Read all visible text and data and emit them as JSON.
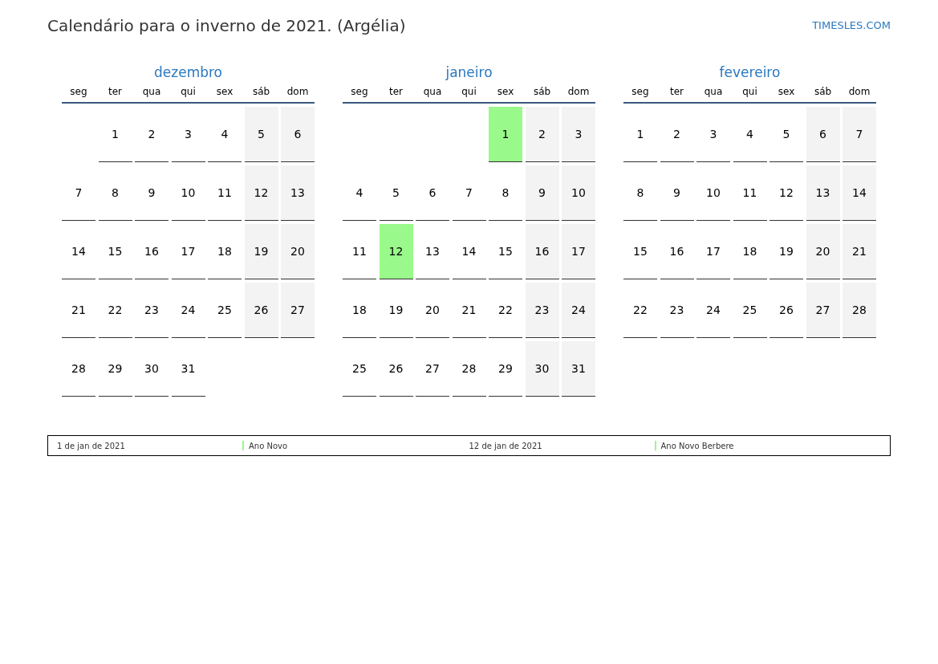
{
  "title": "Calendário para o inverno de 2021. (Argélia)",
  "site": "TIMESLES.COM",
  "months": [
    {
      "name": "dezembro",
      "weekdays": [
        "seg",
        "ter",
        "qua",
        "qui",
        "sex",
        "sáb",
        "dom"
      ],
      "weeks": [
        [
          {
            "kind": "blank"
          },
          {
            "kind": "day",
            "day": "1",
            "weekend": false,
            "holiday": false
          },
          {
            "kind": "day",
            "day": "2",
            "weekend": false,
            "holiday": false
          },
          {
            "kind": "day",
            "day": "3",
            "weekend": false,
            "holiday": false
          },
          {
            "kind": "day",
            "day": "4",
            "weekend": false,
            "holiday": false
          },
          {
            "kind": "day",
            "day": "5",
            "weekend": true,
            "holiday": false
          },
          {
            "kind": "day",
            "day": "6",
            "weekend": true,
            "holiday": false
          }
        ],
        [
          {
            "kind": "day",
            "day": "7",
            "weekend": false,
            "holiday": false
          },
          {
            "kind": "day",
            "day": "8",
            "weekend": false,
            "holiday": false
          },
          {
            "kind": "day",
            "day": "9",
            "weekend": false,
            "holiday": false
          },
          {
            "kind": "day",
            "day": "10",
            "weekend": false,
            "holiday": false
          },
          {
            "kind": "day",
            "day": "11",
            "weekend": false,
            "holiday": false
          },
          {
            "kind": "day",
            "day": "12",
            "weekend": true,
            "holiday": false
          },
          {
            "kind": "day",
            "day": "13",
            "weekend": true,
            "holiday": false
          }
        ],
        [
          {
            "kind": "day",
            "day": "14",
            "weekend": false,
            "holiday": false
          },
          {
            "kind": "day",
            "day": "15",
            "weekend": false,
            "holiday": false
          },
          {
            "kind": "day",
            "day": "16",
            "weekend": false,
            "holiday": false
          },
          {
            "kind": "day",
            "day": "17",
            "weekend": false,
            "holiday": false
          },
          {
            "kind": "day",
            "day": "18",
            "weekend": false,
            "holiday": false
          },
          {
            "kind": "day",
            "day": "19",
            "weekend": true,
            "holiday": false
          },
          {
            "kind": "day",
            "day": "20",
            "weekend": true,
            "holiday": false
          }
        ],
        [
          {
            "kind": "day",
            "day": "21",
            "weekend": false,
            "holiday": false
          },
          {
            "kind": "day",
            "day": "22",
            "weekend": false,
            "holiday": false
          },
          {
            "kind": "day",
            "day": "23",
            "weekend": false,
            "holiday": false
          },
          {
            "kind": "day",
            "day": "24",
            "weekend": false,
            "holiday": false
          },
          {
            "kind": "day",
            "day": "25",
            "weekend": false,
            "holiday": false
          },
          {
            "kind": "day",
            "day": "26",
            "weekend": true,
            "holiday": false
          },
          {
            "kind": "day",
            "day": "27",
            "weekend": true,
            "holiday": false
          }
        ],
        [
          {
            "kind": "day",
            "day": "28",
            "weekend": false,
            "holiday": false
          },
          {
            "kind": "day",
            "day": "29",
            "weekend": false,
            "holiday": false
          },
          {
            "kind": "day",
            "day": "30",
            "weekend": false,
            "holiday": false
          },
          {
            "kind": "day",
            "day": "31",
            "weekend": false,
            "holiday": false
          }
        ]
      ]
    },
    {
      "name": "janeiro",
      "weekdays": [
        "seg",
        "ter",
        "qua",
        "qui",
        "sex",
        "sáb",
        "dom"
      ],
      "weeks": [
        [
          {
            "kind": "blank"
          },
          {
            "kind": "blank"
          },
          {
            "kind": "blank"
          },
          {
            "kind": "blank"
          },
          {
            "kind": "day",
            "day": "1",
            "weekend": false,
            "holiday": true
          },
          {
            "kind": "day",
            "day": "2",
            "weekend": true,
            "holiday": false
          },
          {
            "kind": "day",
            "day": "3",
            "weekend": true,
            "holiday": false
          }
        ],
        [
          {
            "kind": "day",
            "day": "4",
            "weekend": false,
            "holiday": false
          },
          {
            "kind": "day",
            "day": "5",
            "weekend": false,
            "holiday": false
          },
          {
            "kind": "day",
            "day": "6",
            "weekend": false,
            "holiday": false
          },
          {
            "kind": "day",
            "day": "7",
            "weekend": false,
            "holiday": false
          },
          {
            "kind": "day",
            "day": "8",
            "weekend": false,
            "holiday": false
          },
          {
            "kind": "day",
            "day": "9",
            "weekend": true,
            "holiday": false
          },
          {
            "kind": "day",
            "day": "10",
            "weekend": true,
            "holiday": false
          }
        ],
        [
          {
            "kind": "day",
            "day": "11",
            "weekend": false,
            "holiday": false
          },
          {
            "kind": "day",
            "day": "12",
            "weekend": false,
            "holiday": true
          },
          {
            "kind": "day",
            "day": "13",
            "weekend": false,
            "holiday": false
          },
          {
            "kind": "day",
            "day": "14",
            "weekend": false,
            "holiday": false
          },
          {
            "kind": "day",
            "day": "15",
            "weekend": false,
            "holiday": false
          },
          {
            "kind": "day",
            "day": "16",
            "weekend": true,
            "holiday": false
          },
          {
            "kind": "day",
            "day": "17",
            "weekend": true,
            "holiday": false
          }
        ],
        [
          {
            "kind": "day",
            "day": "18",
            "weekend": false,
            "holiday": false
          },
          {
            "kind": "day",
            "day": "19",
            "weekend": false,
            "holiday": false
          },
          {
            "kind": "day",
            "day": "20",
            "weekend": false,
            "holiday": false
          },
          {
            "kind": "day",
            "day": "21",
            "weekend": false,
            "holiday": false
          },
          {
            "kind": "day",
            "day": "22",
            "weekend": false,
            "holiday": false
          },
          {
            "kind": "day",
            "day": "23",
            "weekend": true,
            "holiday": false
          },
          {
            "kind": "day",
            "day": "24",
            "weekend": true,
            "holiday": false
          }
        ],
        [
          {
            "kind": "day",
            "day": "25",
            "weekend": false,
            "holiday": false
          },
          {
            "kind": "day",
            "day": "26",
            "weekend": false,
            "holiday": false
          },
          {
            "kind": "day",
            "day": "27",
            "weekend": false,
            "holiday": false
          },
          {
            "kind": "day",
            "day": "28",
            "weekend": false,
            "holiday": false
          },
          {
            "kind": "day",
            "day": "29",
            "weekend": false,
            "holiday": false
          },
          {
            "kind": "day",
            "day": "30",
            "weekend": true,
            "holiday": false
          },
          {
            "kind": "day",
            "day": "31",
            "weekend": true,
            "holiday": false
          }
        ]
      ]
    },
    {
      "name": "fevereiro",
      "weekdays": [
        "seg",
        "ter",
        "qua",
        "qui",
        "sex",
        "sáb",
        "dom"
      ],
      "weeks": [
        [
          {
            "kind": "day",
            "day": "1",
            "weekend": false,
            "holiday": false
          },
          {
            "kind": "day",
            "day": "2",
            "weekend": false,
            "holiday": false
          },
          {
            "kind": "day",
            "day": "3",
            "weekend": false,
            "holiday": false
          },
          {
            "kind": "day",
            "day": "4",
            "weekend": false,
            "holiday": false
          },
          {
            "kind": "day",
            "day": "5",
            "weekend": false,
            "holiday": false
          },
          {
            "kind": "day",
            "day": "6",
            "weekend": true,
            "holiday": false
          },
          {
            "kind": "day",
            "day": "7",
            "weekend": true,
            "holiday": false
          }
        ],
        [
          {
            "kind": "day",
            "day": "8",
            "weekend": false,
            "holiday": false
          },
          {
            "kind": "day",
            "day": "9",
            "weekend": false,
            "holiday": false
          },
          {
            "kind": "day",
            "day": "10",
            "weekend": false,
            "holiday": false
          },
          {
            "kind": "day",
            "day": "11",
            "weekend": false,
            "holiday": false
          },
          {
            "kind": "day",
            "day": "12",
            "weekend": false,
            "holiday": false
          },
          {
            "kind": "day",
            "day": "13",
            "weekend": true,
            "holiday": false
          },
          {
            "kind": "day",
            "day": "14",
            "weekend": true,
            "holiday": false
          }
        ],
        [
          {
            "kind": "day",
            "day": "15",
            "weekend": false,
            "holiday": false
          },
          {
            "kind": "day",
            "day": "16",
            "weekend": false,
            "holiday": false
          },
          {
            "kind": "day",
            "day": "17",
            "weekend": false,
            "holiday": false
          },
          {
            "kind": "day",
            "day": "18",
            "weekend": false,
            "holiday": false
          },
          {
            "kind": "day",
            "day": "19",
            "weekend": false,
            "holiday": false
          },
          {
            "kind": "day",
            "day": "20",
            "weekend": true,
            "holiday": false
          },
          {
            "kind": "day",
            "day": "21",
            "weekend": true,
            "holiday": false
          }
        ],
        [
          {
            "kind": "day",
            "day": "22",
            "weekend": false,
            "holiday": false
          },
          {
            "kind": "day",
            "day": "23",
            "weekend": false,
            "holiday": false
          },
          {
            "kind": "day",
            "day": "24",
            "weekend": false,
            "holiday": false
          },
          {
            "kind": "day",
            "day": "25",
            "weekend": false,
            "holiday": false
          },
          {
            "kind": "day",
            "day": "26",
            "weekend": false,
            "holiday": false
          },
          {
            "kind": "day",
            "day": "27",
            "weekend": true,
            "holiday": false
          },
          {
            "kind": "day",
            "day": "28",
            "weekend": true,
            "holiday": false
          }
        ]
      ]
    }
  ],
  "holidays": [
    {
      "date": "1 de jan de 2021",
      "name": "Ano Novo"
    },
    {
      "date": "12 de jan de 2021",
      "name": "Ano Novo Berbere"
    }
  ]
}
